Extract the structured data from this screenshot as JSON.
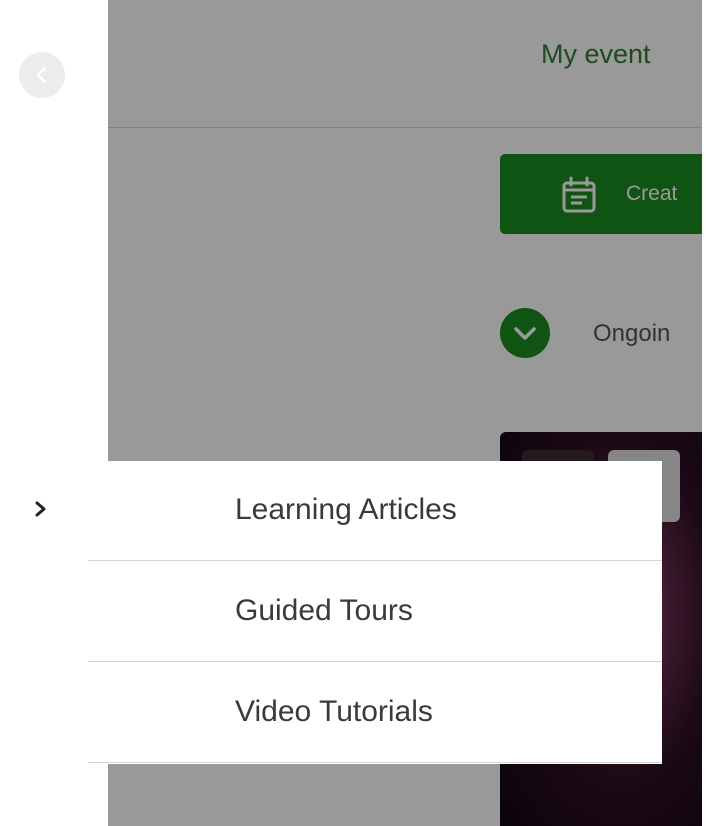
{
  "header": {
    "title": "My event"
  },
  "actions": {
    "create_label": "Creat"
  },
  "sections": {
    "ongoing_label": "Ongoin"
  },
  "menu": {
    "items": [
      {
        "label": "Learning Articles"
      },
      {
        "label": "Guided Tours"
      },
      {
        "label": "Video Tutorials"
      }
    ]
  },
  "colors": {
    "accent": "#1b8c22",
    "title_green": "#2e7d32",
    "overlay": "rgba(0,0,0,0.40)",
    "menu_text": "#3a3a3a"
  },
  "icons": {
    "back": "chevron-left-icon",
    "create": "calendar-icon",
    "ongoing": "chevron-down-icon",
    "menu_active": "chevron-right-icon"
  }
}
